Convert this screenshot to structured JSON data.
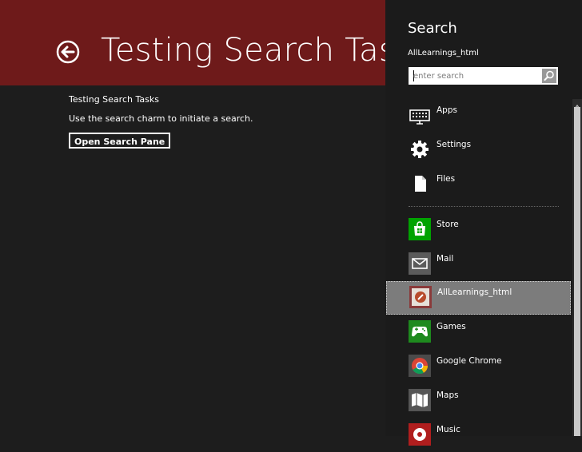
{
  "app": {
    "title": "Testing Search Tasks",
    "header_color": "#6e1a1a",
    "content_heading": "Testing Search Tasks",
    "content_description": "Use the search charm to initiate a search.",
    "open_button_label": "Open Search Pane"
  },
  "search_pane": {
    "title": "Search",
    "scope": "AllLearnings_html",
    "placeholder": "enter search",
    "search_icon": "magnifier-icon"
  },
  "results": {
    "system": [
      {
        "label": "Apps",
        "icon": "keyboard-icon"
      },
      {
        "label": "Settings",
        "icon": "gear-icon"
      },
      {
        "label": "Files",
        "icon": "document-icon"
      }
    ],
    "apps": [
      {
        "label": "Store",
        "icon": "store-icon",
        "color": "#00a300"
      },
      {
        "label": "Mail",
        "icon": "mail-icon",
        "color": "#5b5b5b"
      },
      {
        "label": "AllLearnings_html",
        "icon": "app-icon",
        "color": "#8a3a3a",
        "selected": true
      },
      {
        "label": "Games",
        "icon": "gamepad-icon",
        "color": "#1e8a1e"
      },
      {
        "label": "Google Chrome",
        "icon": "chrome-icon",
        "color": "#4a4a4a"
      },
      {
        "label": "Maps",
        "icon": "map-icon",
        "color": "#555555"
      },
      {
        "label": "Music",
        "icon": "music-icon",
        "color": "#b01e1e"
      }
    ]
  }
}
